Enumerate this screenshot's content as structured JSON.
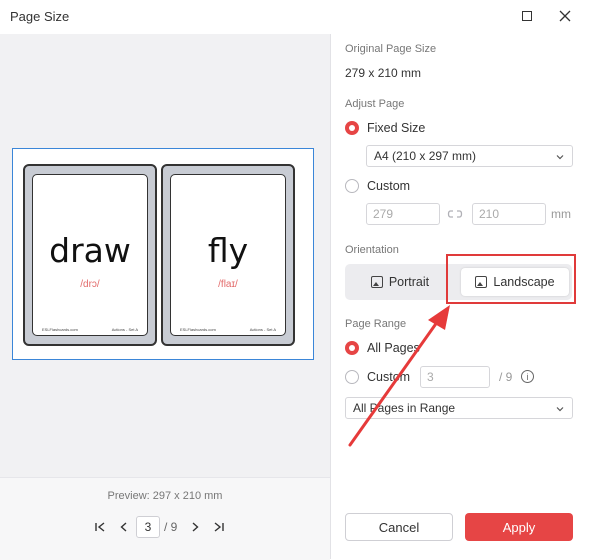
{
  "window": {
    "title": "Page Size",
    "maximize_icon": "square-icon",
    "close_icon": "x-icon"
  },
  "preview": {
    "cards": [
      {
        "word": "draw",
        "ipa": "/drɔ/",
        "footer_left": "ESLFlashcards.com",
        "footer_right": "Actions - Set A"
      },
      {
        "word": "fly",
        "ipa": "/flaɪ/",
        "footer_left": "ESLFlashcards.com",
        "footer_right": "Actions - Set A"
      }
    ],
    "label": "Preview: 297 x 210 mm"
  },
  "pager": {
    "first": "⏮",
    "prev": "‹",
    "current": "3",
    "total": "/ 9",
    "next": "›",
    "last": "⏭"
  },
  "original": {
    "label": "Original Page Size",
    "value": "279 x 210 mm"
  },
  "adjust": {
    "label": "Adjust Page",
    "fixed_label": "Fixed Size",
    "fixed_selected": "A4 (210 x 297 mm)",
    "custom_label": "Custom",
    "width": "279",
    "height": "210",
    "unit": "mm",
    "link_icon": "link-icon"
  },
  "orientation": {
    "label": "Orientation",
    "portrait": "Portrait",
    "landscape": "Landscape",
    "selected": "Landscape"
  },
  "range": {
    "label": "Page Range",
    "all_label": "All Pages",
    "custom_label": "Custom",
    "custom_value": "3",
    "custom_total": "/ 9",
    "subset_selected": "All Pages in Range"
  },
  "buttons": {
    "cancel": "Cancel",
    "apply": "Apply"
  },
  "colors": {
    "accent": "#e64545",
    "highlight": "#e03a3a",
    "selection_border": "#3b86d8"
  }
}
